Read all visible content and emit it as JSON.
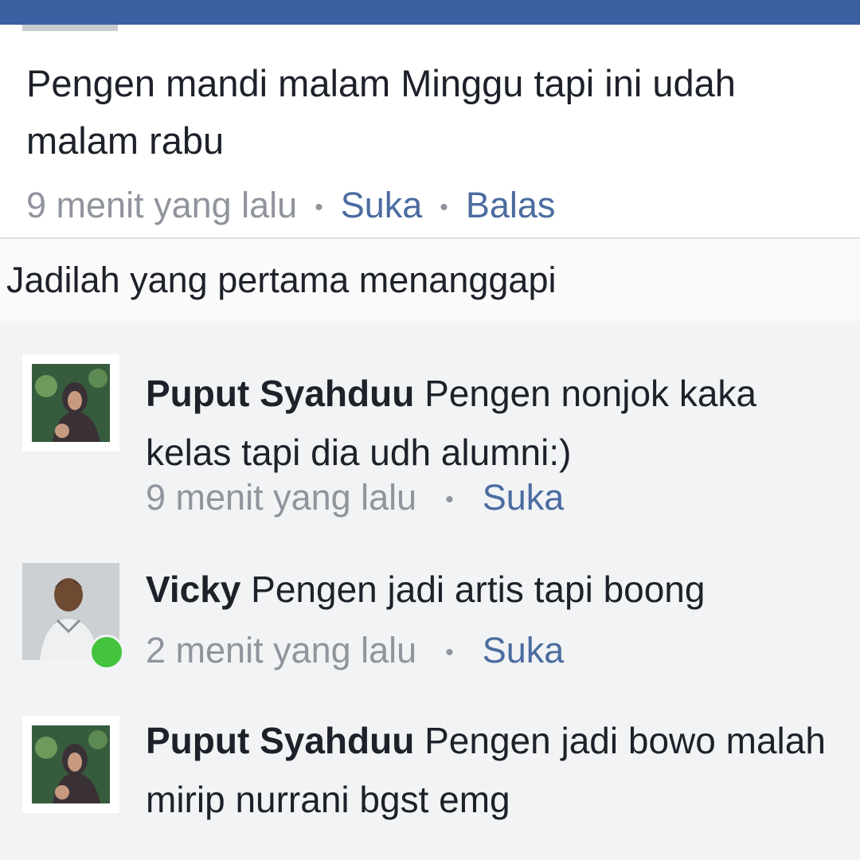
{
  "post": {
    "text": "Pengen mandi malam Minggu tapi ini udah malam rabu",
    "time": "9 menit yang lalu",
    "like_label": "Suka",
    "reply_label": "Balas"
  },
  "first_reply_prompt": "Jadilah yang pertama menanggapi",
  "comments": [
    {
      "author": "Puput Syahduu",
      "text": "Pengen nonjok kaka kelas tapi dia udh alumni:)",
      "time": "9 menit yang lalu",
      "like_label": "Suka"
    },
    {
      "author": "Vicky",
      "text": "Pengen jadi artis tapi boong",
      "time": "2 menit yang lalu",
      "like_label": "Suka",
      "online": true
    },
    {
      "author": "Puput Syahduu",
      "text": "Pengen jadi bowo malah mirip nurrani bgst emg"
    }
  ],
  "colors": {
    "header_blue": "#3b5fa0",
    "link_blue": "#4b6ca0",
    "meta_gray": "#90949c",
    "online_green": "#44c43e",
    "comments_bg": "#f1f3f5"
  }
}
